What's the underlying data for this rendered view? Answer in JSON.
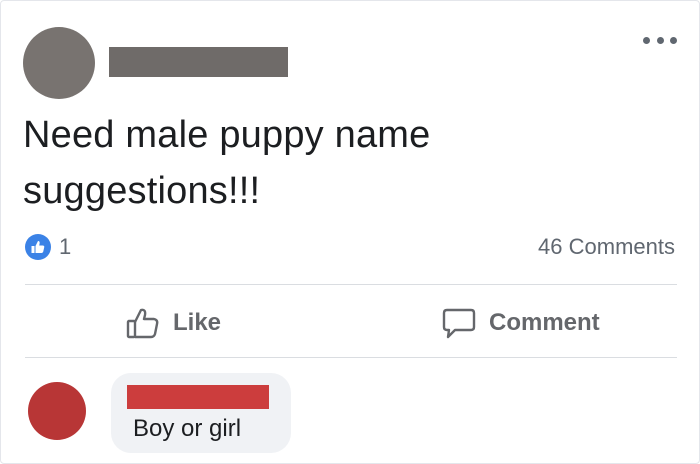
{
  "post": {
    "text": "Need male puppy name suggestions!!!",
    "reaction_count": "1",
    "comments_count": "46 Comments"
  },
  "actions": {
    "like_label": "Like",
    "comment_label": "Comment"
  },
  "comment": {
    "text": "Boy or girl"
  },
  "icons": {
    "more": "more-options-icon",
    "like_badge": "thumbs-up-icon",
    "like_action": "thumbs-up-outline-icon",
    "comment_action": "speech-bubble-icon"
  },
  "colors": {
    "like_blue": "#3b82e6",
    "redaction_post": "#6f6b69",
    "redaction_comment": "#cc3d3d",
    "commenter_avatar": "#b83636"
  }
}
